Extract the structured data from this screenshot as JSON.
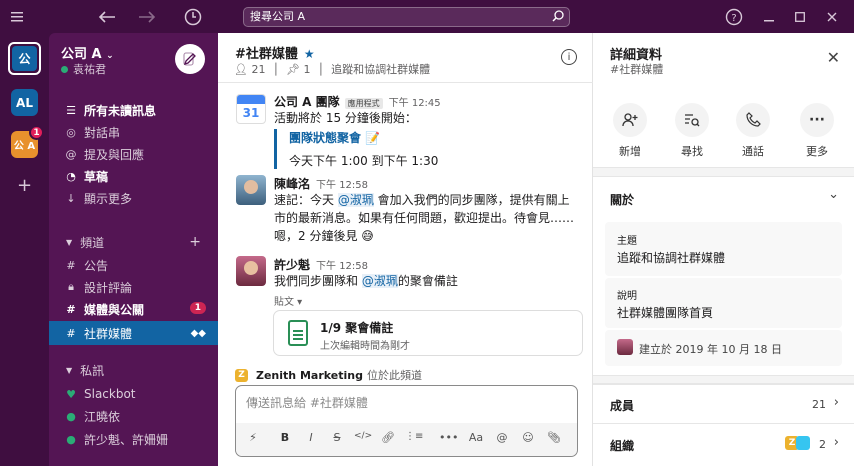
{
  "titlebar": {
    "search_text": "搜尋公司 A"
  },
  "rail": {
    "workspaces": [
      {
        "initials": "公"
      },
      {
        "initials": "AL"
      },
      {
        "initials": "公 A",
        "badge": "1"
      }
    ]
  },
  "sidebar": {
    "workspace_name": "公司 A",
    "user_name": "袁祐君",
    "top_items": [
      "所有未讀訊息",
      "對話串",
      "提及與回應",
      "草稿",
      "顯示更多"
    ],
    "channels_header": "頻道",
    "channels": [
      {
        "name": "公告"
      },
      {
        "name": "設計評論"
      },
      {
        "name": "媒體與公關",
        "badge": "1"
      },
      {
        "name": "社群媒體"
      }
    ],
    "dm_header": "私訊",
    "dms": [
      "Slackbot",
      "江曉依",
      "許少魁、許姍姍"
    ]
  },
  "channel": {
    "name": "#社群媒體",
    "members": "21",
    "pins": "1",
    "topic": "追蹤和協調社群媒體"
  },
  "messages": {
    "m1": {
      "name": "公司 A 團隊",
      "tag": "應用程式",
      "time": "下午 12:45",
      "text": "活動將於 15 分鐘後開始：",
      "quote_title": "團隊狀態聚會 📝",
      "quote_body": "今天下午 1:00 到下午 1:30",
      "calendar_day": "31"
    },
    "m2": {
      "name": "陳峰洺",
      "time": "下午 12:58",
      "text_a": "速記：今天 ",
      "mention": "@淑珮",
      "text_b": " 會加入我們的同步團隊，提供有關上市的最新消息。如果有任何問題，歡迎提出。待會見……嗯，2 分鐘後見 😅"
    },
    "m3": {
      "name": "許少魁",
      "time": "下午 12:58",
      "text_a": "我們同步團隊和 ",
      "mention": "@淑珮",
      "text_b": "的聚會備註",
      "file_label": "貼文 ▾",
      "file_title": "1/9 聚會備註",
      "file_sub": "上次編輯時間為剛才"
    }
  },
  "note": {
    "app": "Zenith Marketing",
    "text": "位於此頻道"
  },
  "composer": {
    "placeholder": "傳送訊息給 #社群媒體"
  },
  "details": {
    "title": "詳細資料",
    "subtitle": "#社群媒體",
    "actions": [
      "新增",
      "尋找",
      "通話",
      "更多"
    ],
    "about_header": "關於",
    "topic_label": "主題",
    "topic_value": "追蹤和協調社群媒體",
    "desc_label": "說明",
    "desc_value": "社群媒體團隊首頁",
    "created": "建立於 2019 年 10 月 18 日",
    "members_label": "成員",
    "members_count": "21",
    "org_label": "組織",
    "org_count": "2",
    "org_logo": "Z"
  },
  "colors": {
    "aubergine": "#3f0e40",
    "sidebar": "#541554",
    "selected": "#1264a3",
    "badge": "#cd2553"
  }
}
